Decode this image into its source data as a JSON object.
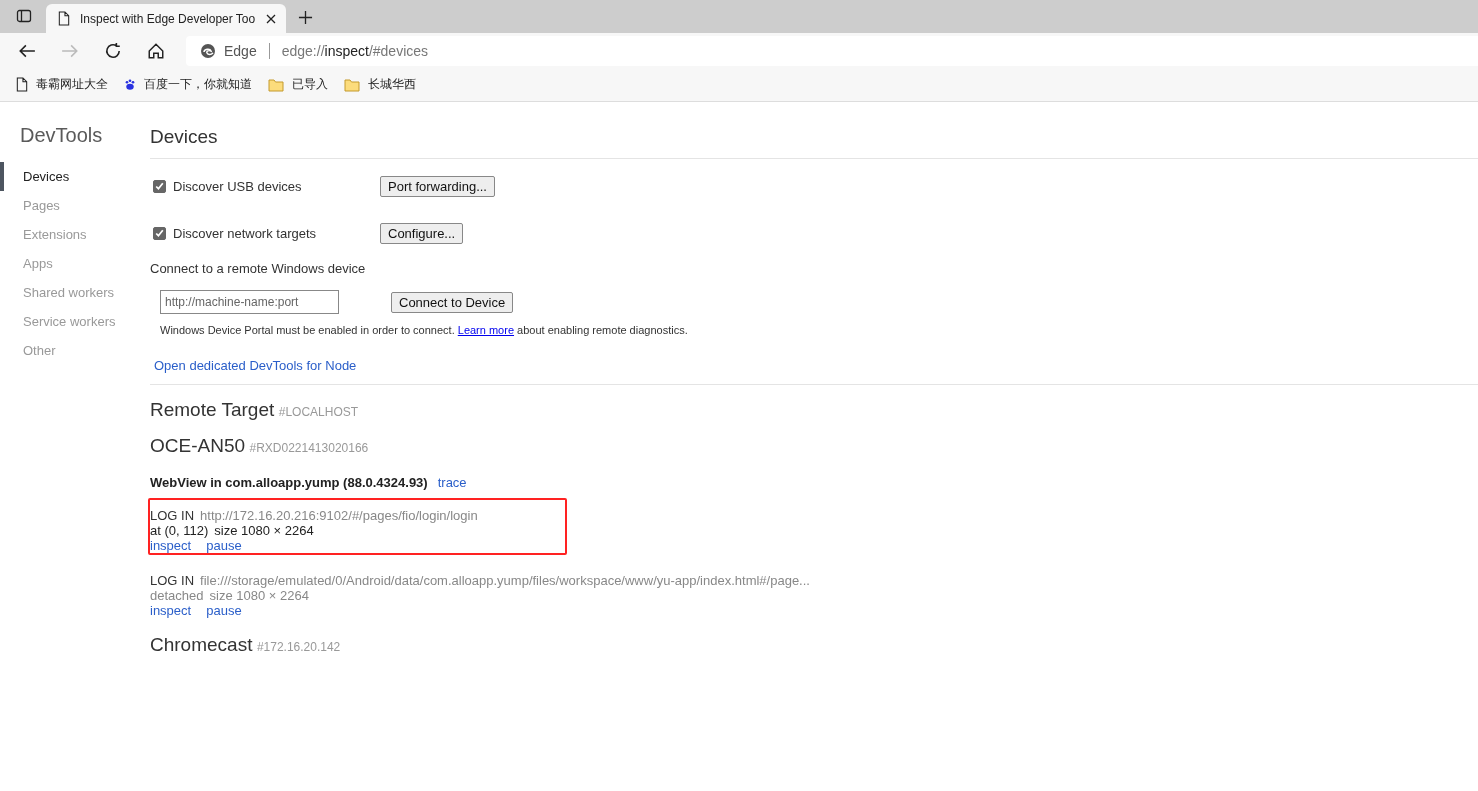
{
  "browser": {
    "tab": {
      "title": "Inspect with Edge Developer Too"
    },
    "address": {
      "site": "Edge",
      "url_prefix": "edge://",
      "url_host": "inspect",
      "url_path": "/#devices"
    },
    "bookmarks": [
      {
        "kind": "page",
        "label": "毒霸网址大全"
      },
      {
        "kind": "paw",
        "label": "百度一下，你就知道"
      },
      {
        "kind": "folder",
        "label": "已导入"
      },
      {
        "kind": "folder",
        "label": "长城华西"
      }
    ]
  },
  "sidebar": {
    "title": "DevTools",
    "items": [
      {
        "label": "Devices",
        "selected": true
      },
      {
        "label": "Pages",
        "selected": false
      },
      {
        "label": "Extensions",
        "selected": false
      },
      {
        "label": "Apps",
        "selected": false
      },
      {
        "label": "Shared workers",
        "selected": false
      },
      {
        "label": "Service workers",
        "selected": false
      },
      {
        "label": "Other",
        "selected": false
      }
    ]
  },
  "main": {
    "title": "Devices",
    "options": [
      {
        "label": "Discover USB devices",
        "checked": true,
        "button": "Port forwarding..."
      },
      {
        "label": "Discover network targets",
        "checked": true,
        "button": "Configure..."
      }
    ],
    "remote": {
      "heading": "Connect to a remote Windows device",
      "placeholder": "http://machine-name:port",
      "button": "Connect to Device",
      "note_before": "Windows Device Portal must be enabled in order to connect.",
      "note_link": "Learn more",
      "note_after": "about enabling remote diagnostics."
    },
    "node_link": "Open dedicated DevTools for Node",
    "targets": [
      {
        "name": "Remote Target",
        "id": "#LOCALHOST"
      },
      {
        "name": "OCE-AN50",
        "id": "#RXD0221413020166",
        "browsers": [
          {
            "name": "WebView in com.alloapp.yump (88.0.4324.93)",
            "action": "trace",
            "pages": [
              {
                "title": "LOG IN",
                "url": "http://172.16.20.216:9102/#/pages/fio/login/login",
                "position": "at (0, 112)",
                "size": "size 1080 × 2264",
                "detached": false,
                "highlighted": true,
                "actions": [
                  "inspect",
                  "pause"
                ]
              },
              {
                "title": "LOG IN",
                "url": "file:///storage/emulated/0/Android/data/com.alloapp.yump/files/workspace/www/yu-app/index.html#/page...",
                "position": "detached",
                "size": "size 1080 × 2264",
                "detached": true,
                "highlighted": false,
                "actions": [
                  "inspect",
                  "pause"
                ]
              }
            ]
          }
        ]
      },
      {
        "name": "Chromecast",
        "id": "#172.16.20.142"
      }
    ]
  }
}
